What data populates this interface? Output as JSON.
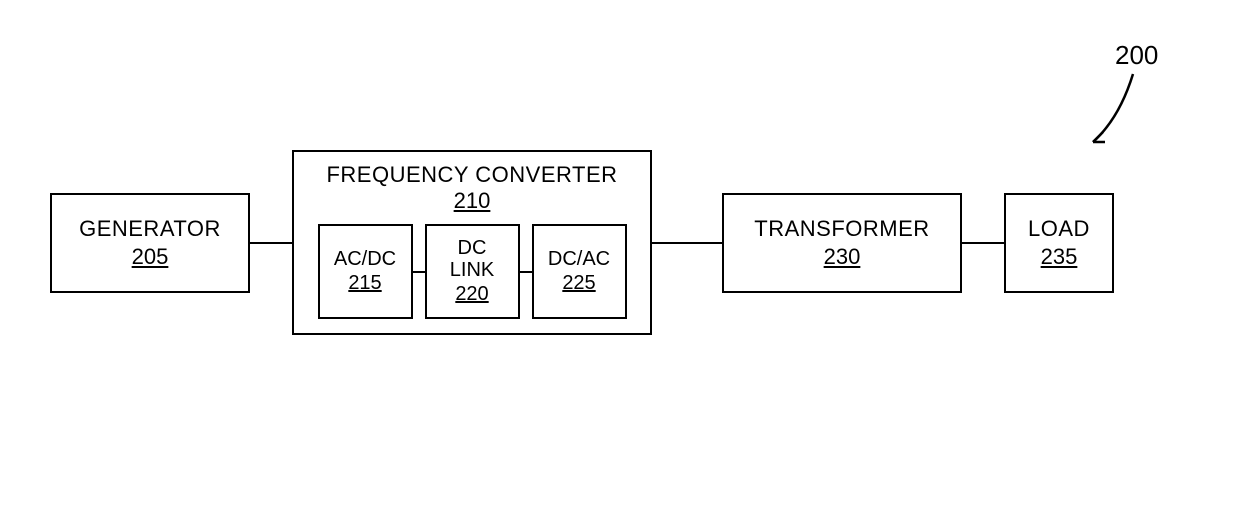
{
  "reference": {
    "number": "200"
  },
  "blocks": {
    "generator": {
      "label": "GENERATOR",
      "number": "205"
    },
    "frequency_converter": {
      "title": "FREQUENCY CONVERTER",
      "number": "210",
      "subs": {
        "acdc": {
          "label": "AC/DC",
          "number": "215"
        },
        "dclink": {
          "label1": "DC",
          "label2": "LINK",
          "number": "220"
        },
        "dcac": {
          "label": "DC/AC",
          "number": "225"
        }
      }
    },
    "transformer": {
      "label": "TRANSFORMER",
      "number": "230"
    },
    "load": {
      "label": "LOAD",
      "number": "235"
    }
  }
}
